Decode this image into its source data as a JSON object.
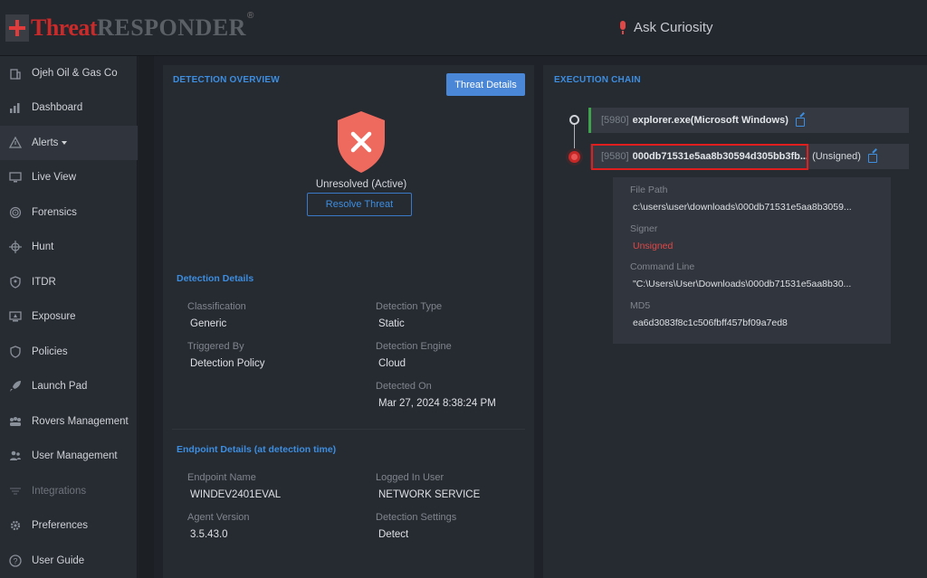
{
  "header": {
    "logo_threat": "Threat",
    "logo_responder": "RESPONDER",
    "logo_reg": "®",
    "ask_label": "Ask Curiosity"
  },
  "sidebar": {
    "items": [
      {
        "label": "Ojeh Oil & Gas Co",
        "icon": "building-icon"
      },
      {
        "label": "Dashboard",
        "icon": "bar-chart-icon"
      },
      {
        "label": "Alerts",
        "icon": "warning-icon"
      },
      {
        "label": "Live View",
        "icon": "monitor-icon"
      },
      {
        "label": "Forensics",
        "icon": "fingerprint-icon"
      },
      {
        "label": "Hunt",
        "icon": "crosshair-icon"
      },
      {
        "label": "ITDR",
        "icon": "id-shield-icon"
      },
      {
        "label": "Exposure",
        "icon": "screen-alert-icon"
      },
      {
        "label": "Policies",
        "icon": "shield-icon"
      },
      {
        "label": "Launch Pad",
        "icon": "rocket-icon"
      },
      {
        "label": "Rovers Management",
        "icon": "rovers-icon"
      },
      {
        "label": "User Management",
        "icon": "users-icon"
      },
      {
        "label": "Integrations",
        "icon": "plug-icon"
      },
      {
        "label": "Preferences",
        "icon": "gear-icon"
      },
      {
        "label": "User Guide",
        "icon": "help-icon"
      }
    ]
  },
  "overview": {
    "title": "DETECTION OVERVIEW",
    "threat_details_btn": "Threat Details",
    "status": "Unresolved (Active)",
    "resolve_btn": "Resolve Threat"
  },
  "detection_details": {
    "title": "Detection Details",
    "classification_label": "Classification",
    "classification": "Generic",
    "detection_type_label": "Detection Type",
    "detection_type": "Static",
    "triggered_by_label": "Triggered By",
    "triggered_by": "Detection Policy",
    "detection_engine_label": "Detection Engine",
    "detection_engine": "Cloud",
    "detected_on_label": "Detected On",
    "detected_on": "Mar 27, 2024 8:38:24 PM"
  },
  "endpoint_details": {
    "title": "Endpoint Details (at detection time)",
    "endpoint_name_label": "Endpoint Name",
    "endpoint_name": "WINDEV2401EVAL",
    "logged_in_user_label": "Logged In User",
    "logged_in_user": "NETWORK SERVICE",
    "agent_version_label": "Agent Version",
    "agent_version": "3.5.43.0",
    "detection_settings_label": "Detection Settings",
    "detection_settings": "Detect"
  },
  "execution_chain": {
    "title": "EXECUTION CHAIN",
    "processes": [
      {
        "pid": "[5980]",
        "name": "explorer.exe(Microsoft Windows)",
        "signer": ""
      },
      {
        "pid": "[9580]",
        "name": "000db71531e5aa8b30594d305bb3fb...",
        "signer": "(Unsigned)"
      }
    ],
    "details": {
      "file_path_label": "File Path",
      "file_path": "c:\\users\\user\\downloads\\000db71531e5aa8b3059...",
      "signer_label": "Signer",
      "signer": "Unsigned",
      "command_line_label": "Command Line",
      "command_line": "\"C:\\Users\\User\\Downloads\\000db71531e5aa8b30...",
      "md5_label": "MD5",
      "md5": "ea6d3083f8c1c506fbff457bf09a7ed8"
    }
  },
  "colors": {
    "accent": "#3d8ee0",
    "danger": "#e04848",
    "brand_red": "#c92a2a",
    "success": "#3fa34d"
  }
}
